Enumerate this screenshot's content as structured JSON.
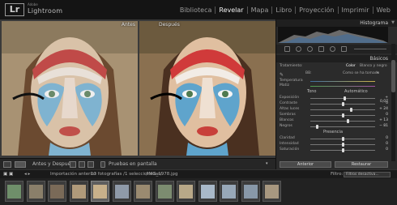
{
  "app": {
    "brand_small": "Adobe",
    "brand": "Lightroom",
    "logo": "Lr",
    "modules": [
      "Biblioteca",
      "Revelar",
      "Mapa",
      "Libro",
      "Proyección",
      "Imprimir",
      "Web"
    ],
    "active_module": "Revelar"
  },
  "viewer": {
    "before_label": "Antes",
    "after_label": "Después",
    "toolbar": {
      "mode_label": "Antes y Después:",
      "proof_label": "Pruebas en pantalla"
    }
  },
  "panel": {
    "histogram_label": "Histograma",
    "basics_label": "Básicos",
    "treatment_label": "Tratamiento:",
    "color_label": "Color",
    "bw_label": "Blanco y negro",
    "wb_label": "Como se ha tomado",
    "temperature_label": "Temperatura",
    "tint_label": "Matiz",
    "tone_label": "Tono",
    "auto_label": "Automático",
    "sliders": [
      {
        "label": "Exposición",
        "value": "+ 0,07",
        "pos": 0.52
      },
      {
        "label": "Contraste",
        "value": "0",
        "pos": 0.5
      },
      {
        "label": "Altas luces",
        "value": "+ 24",
        "pos": 0.62
      },
      {
        "label": "Sombras",
        "value": "0",
        "pos": 0.5
      },
      {
        "label": "Blancos",
        "value": "+ 13",
        "pos": 0.57
      },
      {
        "label": "Negros",
        "value": "− 81",
        "pos": 0.1
      }
    ],
    "presence_label": "Presencia",
    "presence_sliders": [
      {
        "label": "Claridad",
        "value": "0",
        "pos": 0.5
      },
      {
        "label": "Intensidad",
        "value": "0",
        "pos": 0.5
      },
      {
        "label": "Saturación",
        "value": "0",
        "pos": 0.5
      }
    ],
    "previous_button": "Anterior",
    "reset_button": "Restaurar"
  },
  "filmstrip": {
    "import_label": "Importación anterior",
    "count_label": "13 fotografías /1 seleccionadas/",
    "filename": "/IMG_1978.jpg",
    "filter_label": "Filtro:",
    "filter_value": "Filtros desactiva...",
    "selected_index": 4,
    "thumb_count": 13
  },
  "colors": {
    "accent": "#f0f0f0",
    "panel": "#2b2b2b",
    "viewer_bg": "#3a3a3a",
    "face_blue": "#7fb3d0",
    "face_red": "#c0504a"
  }
}
